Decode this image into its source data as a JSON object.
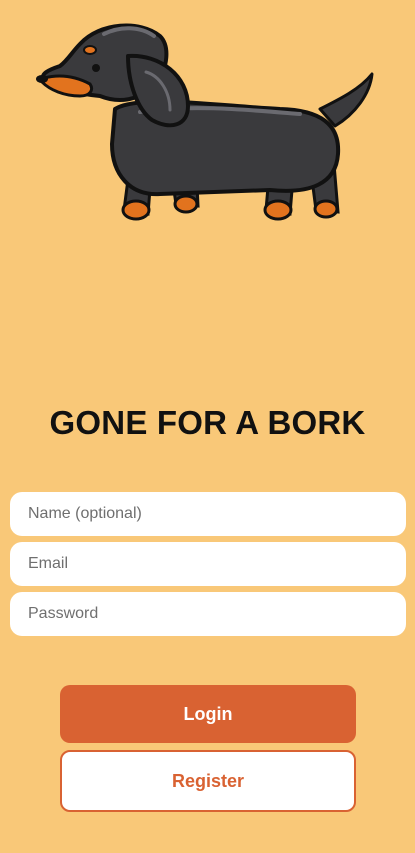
{
  "hero": {
    "image_icon": "dachshund-illustration"
  },
  "title": "GONE FOR A BORK",
  "form": {
    "name_placeholder": "Name (optional)",
    "email_placeholder": "Email",
    "password_placeholder": "Password"
  },
  "actions": {
    "login_label": "Login",
    "register_label": "Register"
  },
  "colors": {
    "background": "#F9C878",
    "accent": "#D96232",
    "field_bg": "#FFFFFF",
    "title_text": "#111111"
  }
}
